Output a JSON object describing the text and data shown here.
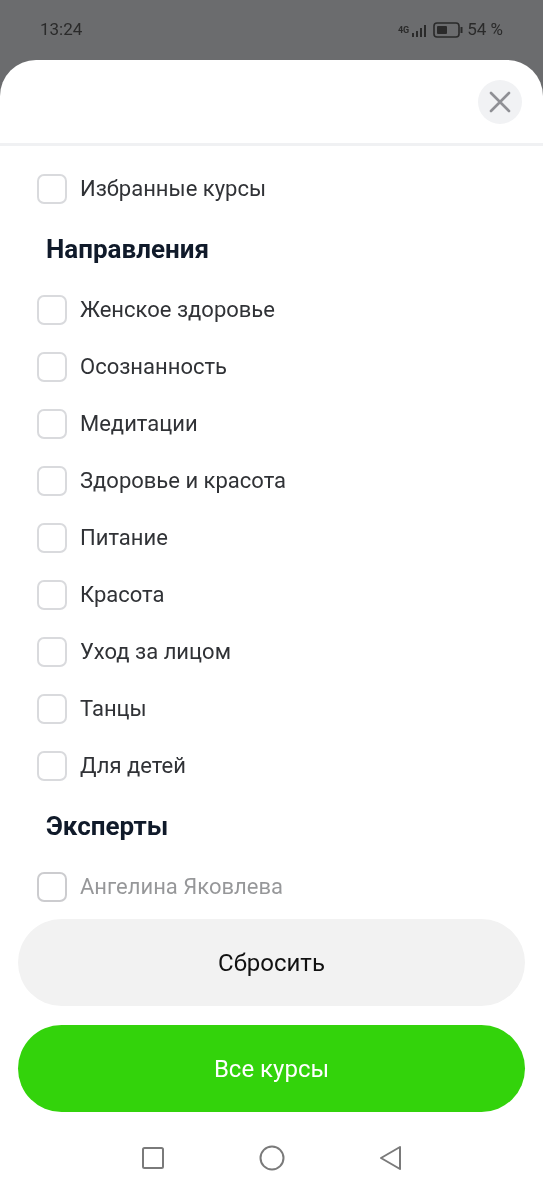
{
  "status_bar": {
    "time": "13:24",
    "network": "4G",
    "battery": "54 %"
  },
  "filters": [
    {
      "kind": "checkbox",
      "label": "Избранные курсы",
      "checked": false,
      "dimmed": false
    },
    {
      "kind": "heading",
      "label": "Направления"
    },
    {
      "kind": "checkbox",
      "label": "Женское здоровье",
      "checked": false,
      "dimmed": false
    },
    {
      "kind": "checkbox",
      "label": "Осознанность",
      "checked": false,
      "dimmed": false
    },
    {
      "kind": "checkbox",
      "label": "Медитации",
      "checked": false,
      "dimmed": false
    },
    {
      "kind": "checkbox",
      "label": "Здоровье и красота",
      "checked": false,
      "dimmed": false
    },
    {
      "kind": "checkbox",
      "label": "Питание",
      "checked": false,
      "dimmed": false
    },
    {
      "kind": "checkbox",
      "label": "Красота",
      "checked": false,
      "dimmed": false
    },
    {
      "kind": "checkbox",
      "label": "Уход за лицом",
      "checked": false,
      "dimmed": false
    },
    {
      "kind": "checkbox",
      "label": "Танцы",
      "checked": false,
      "dimmed": false
    },
    {
      "kind": "checkbox",
      "label": "Для детей",
      "checked": false,
      "dimmed": false
    },
    {
      "kind": "heading",
      "label": "Эксперты"
    },
    {
      "kind": "checkbox",
      "label": "Ангелина Яковлева",
      "checked": false,
      "dimmed": true
    }
  ],
  "buttons": [
    {
      "kind": "secondary",
      "label": "Сбросить"
    },
    {
      "kind": "primary",
      "label": "Все курсы"
    }
  ]
}
